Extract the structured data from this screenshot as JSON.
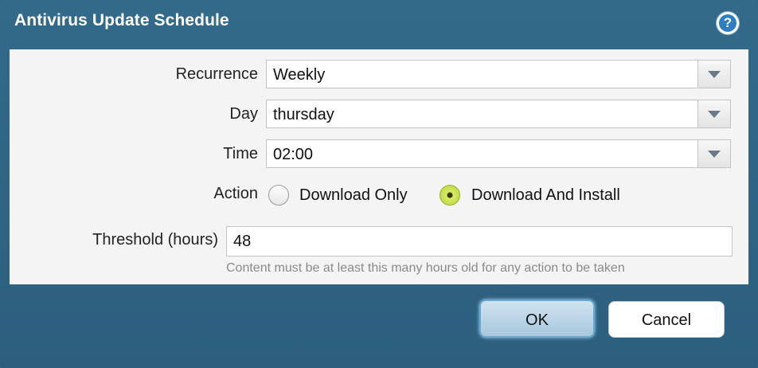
{
  "dialog": {
    "title": "Antivirus Update Schedule",
    "help_icon": "help-icon",
    "help_glyph": "?"
  },
  "form": {
    "recurrence": {
      "label": "Recurrence",
      "value": "Weekly"
    },
    "day": {
      "label": "Day",
      "value": "thursday"
    },
    "time": {
      "label": "Time",
      "value": "02:00"
    },
    "action": {
      "label": "Action",
      "options": [
        "Download Only",
        "Download And Install"
      ],
      "selected": "Download And Install"
    },
    "threshold": {
      "label": "Threshold (hours)",
      "value": "48",
      "hint": "Content must be at least this many hours old for any action to be taken"
    }
  },
  "buttons": {
    "ok": "OK",
    "cancel": "Cancel"
  },
  "colors": {
    "titlebar": "#336a8a",
    "panel": "#f4f4f4",
    "radio_selected": "#c4dc47",
    "ok_button": "#a8c8de"
  }
}
